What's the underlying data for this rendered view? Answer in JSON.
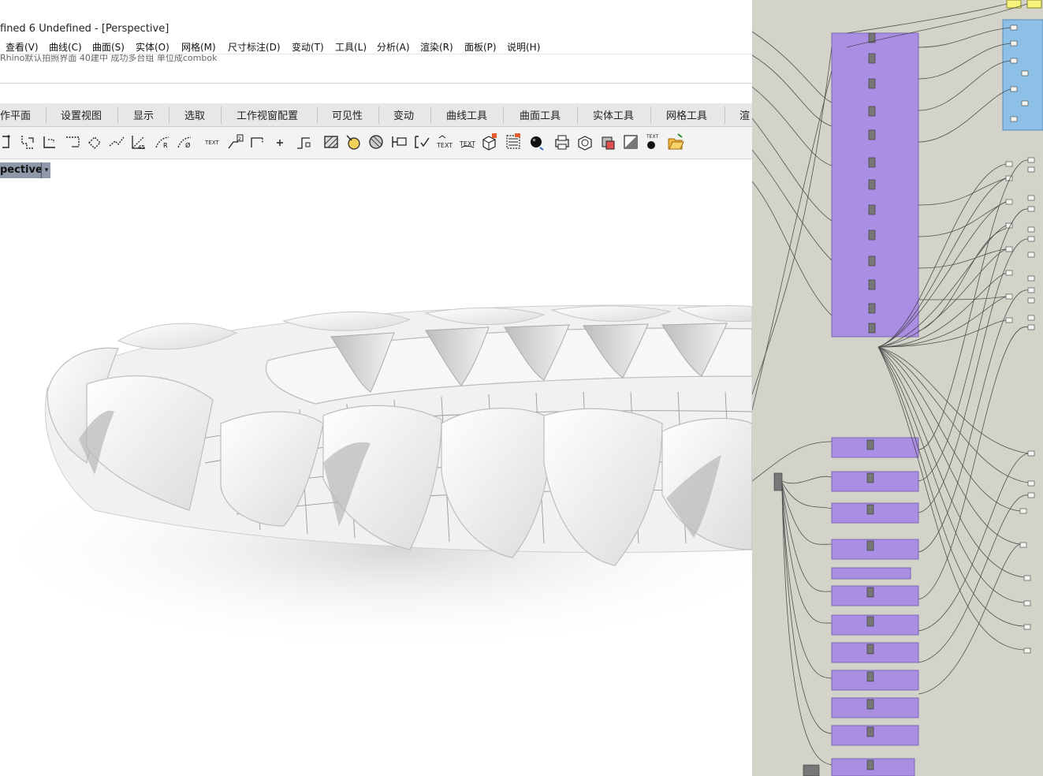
{
  "window": {
    "title": "fined 6 Undefined - [Perspective]"
  },
  "menu": [
    {
      "label": "查看(V)"
    },
    {
      "label": "曲线(C)"
    },
    {
      "label": "曲面(S)"
    },
    {
      "label": "实体(O)"
    },
    {
      "label": "网格(M)"
    },
    {
      "label": "尺寸标注(D)"
    },
    {
      "label": "变动(T)"
    },
    {
      "label": "工具(L)"
    },
    {
      "label": "分析(A)"
    },
    {
      "label": "渲染(R)"
    },
    {
      "label": "面板(P)"
    },
    {
      "label": "说明(H)"
    }
  ],
  "command_line": {
    "text": "Rhino默认拍照界面 40建中 成功多台组 单位成combok"
  },
  "tabs": [
    {
      "label": "作平面"
    },
    {
      "label": "设置视图"
    },
    {
      "label": "显示"
    },
    {
      "label": "选取"
    },
    {
      "label": "工作视窗配置"
    },
    {
      "label": "可见性"
    },
    {
      "label": "变动"
    },
    {
      "label": "曲线工具"
    },
    {
      "label": "曲面工具"
    },
    {
      "label": "实体工具"
    },
    {
      "label": "网格工具"
    },
    {
      "label": "渲"
    }
  ],
  "toolbar_icons": [
    "rotate-curve-icon",
    "polyline-snap-icon",
    "polyline-corner-icon",
    "polyline-open-icon",
    "polyline-diamond-icon",
    "polyline-angle-icon",
    "dimension-45-icon",
    "radius-dim-icon",
    "diameter-dim-icon",
    "text-icon",
    "leader-icon",
    "leader-arrow-icon",
    "point-plus-icon",
    "dimension-break-icon",
    "hatch-icon",
    "hatch-fill-icon",
    "hatch-boundary-icon",
    "block-icon",
    "dimension-check-icon",
    "text-object-icon",
    "text-edit-icon",
    "box-edit-icon",
    "layer-list-icon",
    "render-sphere-icon",
    "print-icon",
    "sphere-wire-icon",
    "box-color-icon",
    "shade-icon",
    "text-annotation-icon",
    "open-folder-icon"
  ],
  "viewport": {
    "name": "pective",
    "dropdown_glyph": "▾"
  },
  "colors": {
    "gh_canvas": "#d4d3ca",
    "gh_purple": "#a98ee3",
    "gh_blue": "#8cc0e6",
    "gh_yellow": "#f6f27a",
    "viewport_tab": "#8e98a8"
  }
}
